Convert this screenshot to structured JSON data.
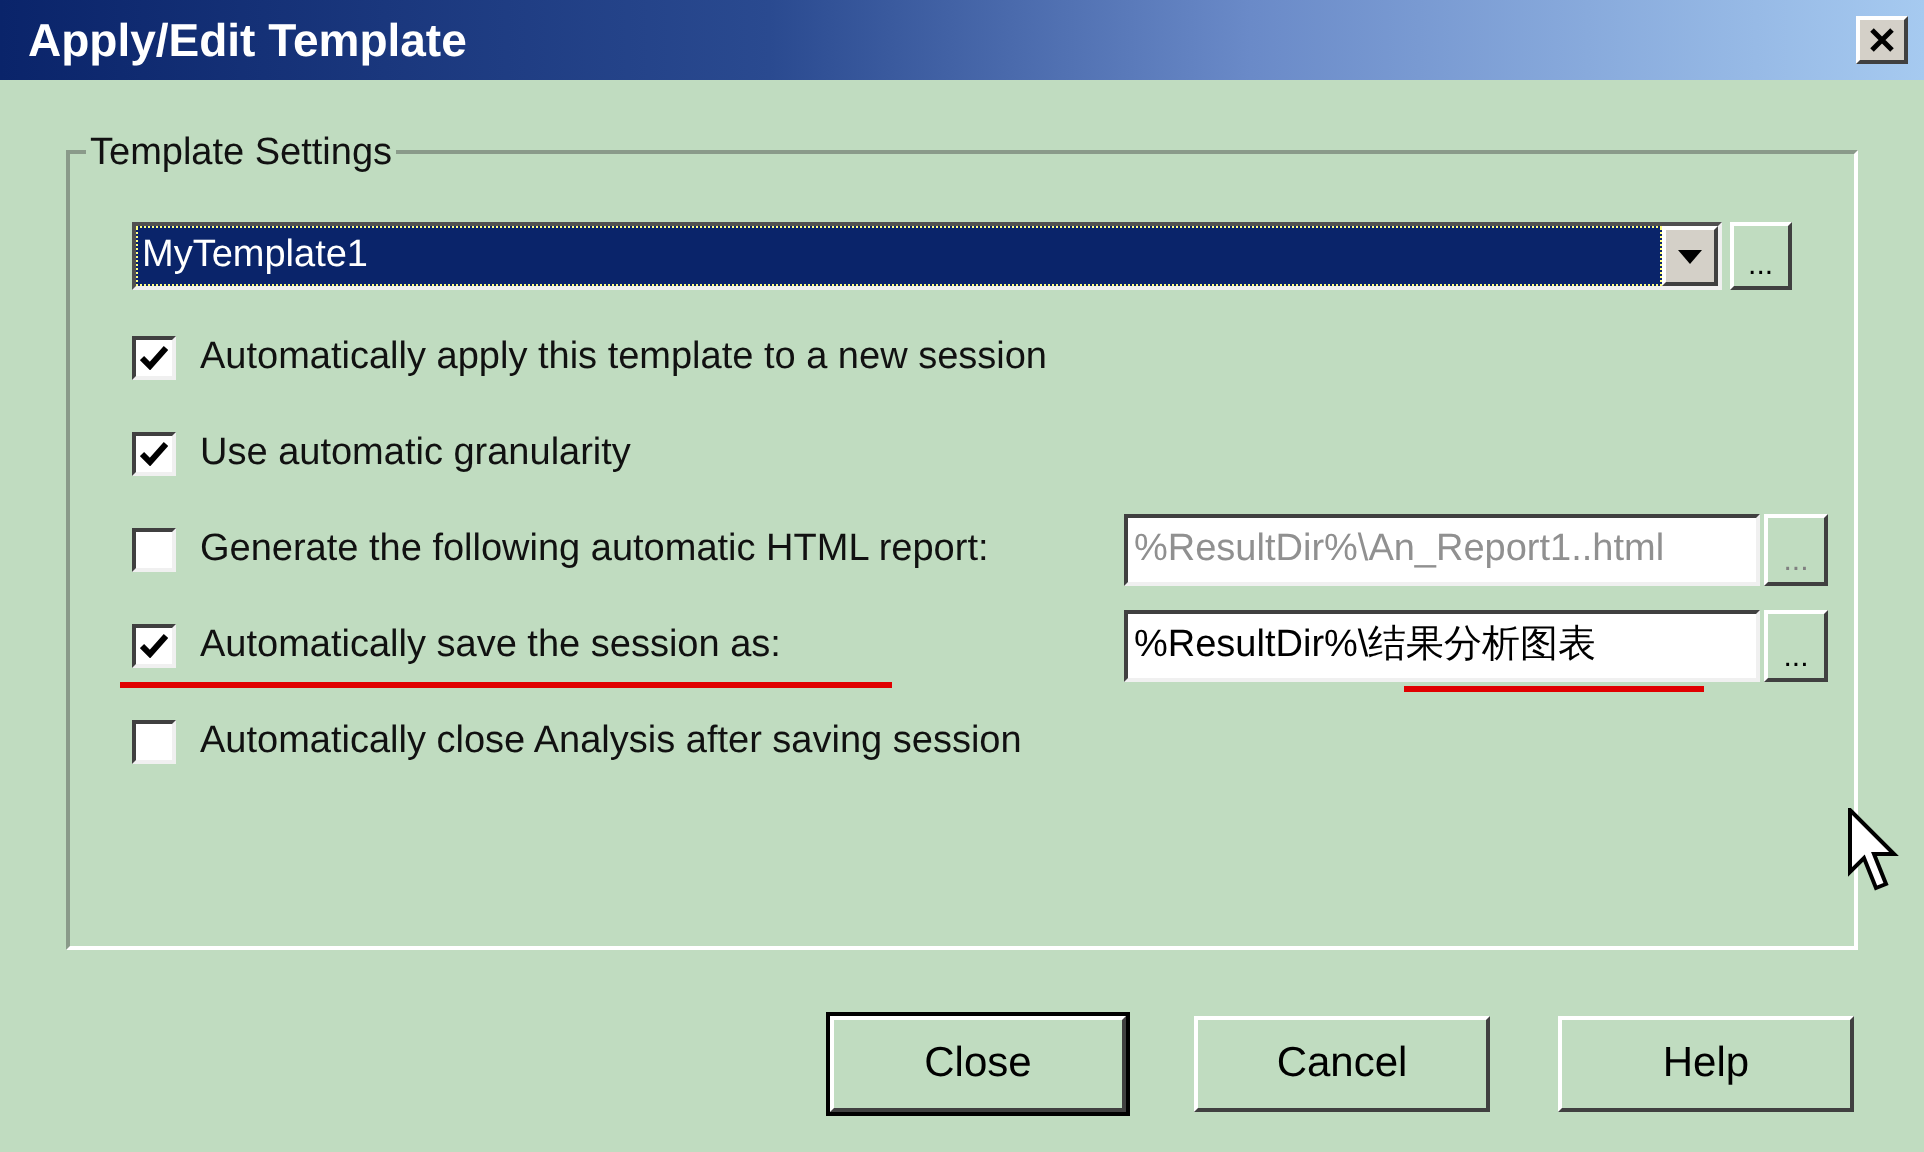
{
  "window": {
    "title": "Apply/Edit Template"
  },
  "group": {
    "label": "Template Settings"
  },
  "template_select": {
    "value": "MyTemplate1",
    "browse_label": "..."
  },
  "options": [
    {
      "label": "Automatically apply this template to a new session",
      "checked": true,
      "marked": false
    },
    {
      "label": "Use automatic granularity",
      "checked": true,
      "marked": false
    },
    {
      "label": "Generate the following automatic HTML report:",
      "checked": false,
      "marked": false,
      "field": {
        "value": "%ResultDir%\\An_Report1..html",
        "disabled": true,
        "marked": false,
        "browse_label": "..."
      }
    },
    {
      "label": "Automatically save the session as:",
      "checked": true,
      "marked": true,
      "field": {
        "value": "%ResultDir%\\结果分析图表",
        "disabled": false,
        "marked": true,
        "browse_label": "..."
      }
    },
    {
      "label": "Automatically close Analysis after saving session",
      "checked": false,
      "marked": false
    }
  ],
  "buttons": [
    {
      "label": "Close",
      "default": true
    },
    {
      "label": "Cancel",
      "default": false
    },
    {
      "label": "Help",
      "default": false
    }
  ]
}
